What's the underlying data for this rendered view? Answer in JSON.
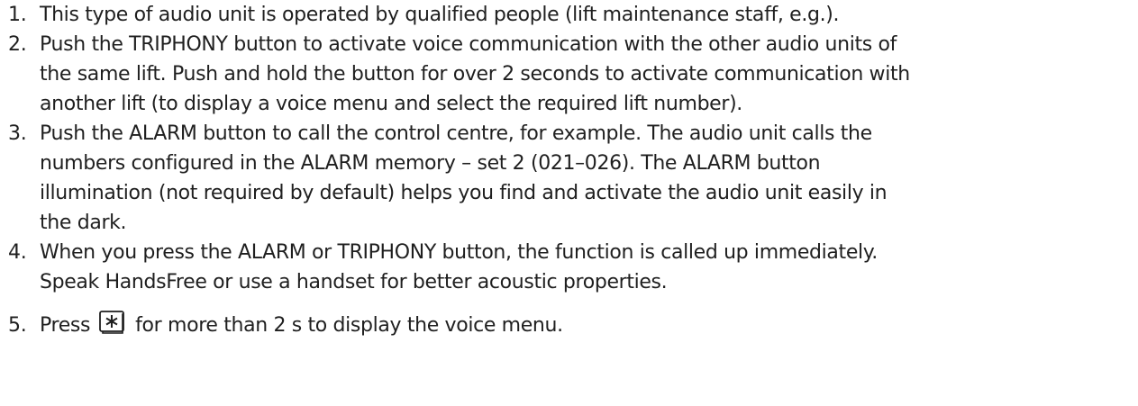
{
  "document": {
    "items": [
      {
        "number": "1.",
        "lines": [
          "This type of audio unit is operated by qualified people (lift maintenance staff, e.g.)."
        ]
      },
      {
        "number": "2.",
        "lines": [
          "Push the TRIPHONY button to activate voice communication with the other audio units of",
          "the same lift. Push and hold the button for over 2 seconds to activate communication with",
          "another lift (to display a voice menu and select the required lift number)."
        ]
      },
      {
        "number": "3.",
        "lines": [
          "Push the ALARM button to call the control centre, for example. The audio unit calls the",
          "numbers configured in the ALARM memory – set 2 (021–026). The ALARM button",
          "illumination (not required by default) helps you find and activate the audio unit easily in",
          "the dark."
        ]
      },
      {
        "number": "4.",
        "lines": [
          "When you press the ALARM or TRIPHONY button, the function is called up immediately.",
          "Speak HandsFree or use a handset for better acoustic properties."
        ]
      },
      {
        "number": "5.",
        "before_icon": "Press",
        "icon": "star-key-icon",
        "after_icon": "for more than 2 s to display the voice menu."
      }
    ]
  }
}
